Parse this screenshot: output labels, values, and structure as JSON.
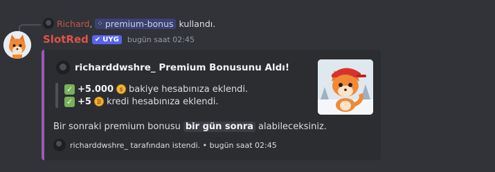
{
  "reply": {
    "user": "Richard",
    "separator": ",",
    "command_icon": "slash-command-icon",
    "command": "premium-bonus",
    "suffix": "kullandı."
  },
  "message": {
    "username": "SlotRed",
    "badge": "UYG",
    "timestamp": "bugün saat 02:45"
  },
  "embed": {
    "accent_color": "#9b59b6",
    "author": "richarddwshre_ Premium Bonusunu Aldı!",
    "lines": [
      {
        "amount": "+5.000",
        "text": "bakiye hesabınıza eklendi."
      },
      {
        "amount": "+5",
        "text": "kredi hesabınıza eklendi."
      }
    ],
    "description_before": "Bir sonraki premium bonusu",
    "description_code": "bir gün sonra",
    "description_after": "alabileceksiniz.",
    "footer": "richarddwshre_ tarafından istendi. • bugün saat 02:45"
  }
}
